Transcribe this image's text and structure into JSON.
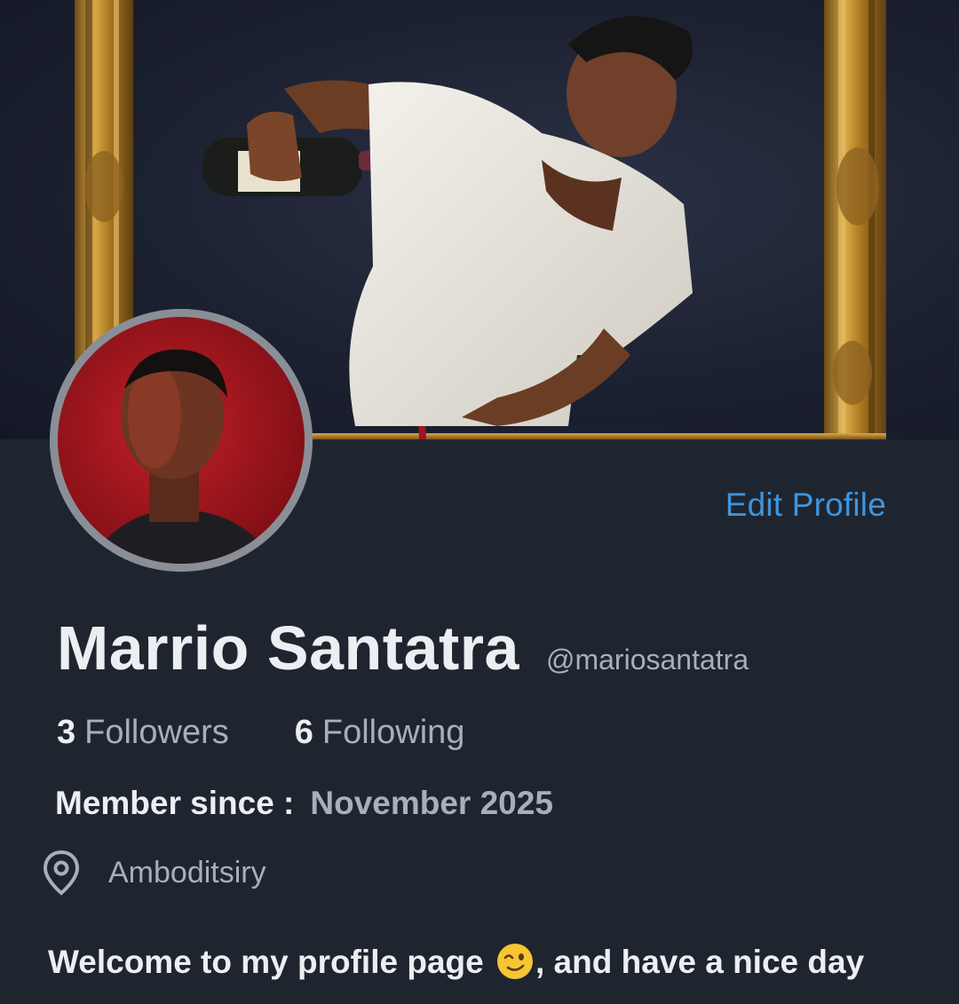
{
  "profile": {
    "display_name": "Marrio Santatra",
    "handle": "@mariosantatra",
    "edit_label": "Edit Profile",
    "followers_count": "3",
    "followers_label": "Followers",
    "following_count": "6",
    "following_label": "Following",
    "member_since_label": "Member since :",
    "member_since_value": "November 2025",
    "location": "Amboditsiry",
    "bio_part1": "Welcome to my profile page",
    "bio_emoji": "winking-face-emoji",
    "bio_part2": ", and have a nice day"
  },
  "icons": {
    "location": "location-pin-icon"
  },
  "colors": {
    "background": "#1f252e",
    "accent": "#3d95df",
    "primary_text": "#eceef1",
    "secondary_text": "#a9afb8",
    "frame_gold": "#b8862e",
    "avatar_ring": "#8a8e96",
    "avatar_bg": "#a3141c"
  }
}
